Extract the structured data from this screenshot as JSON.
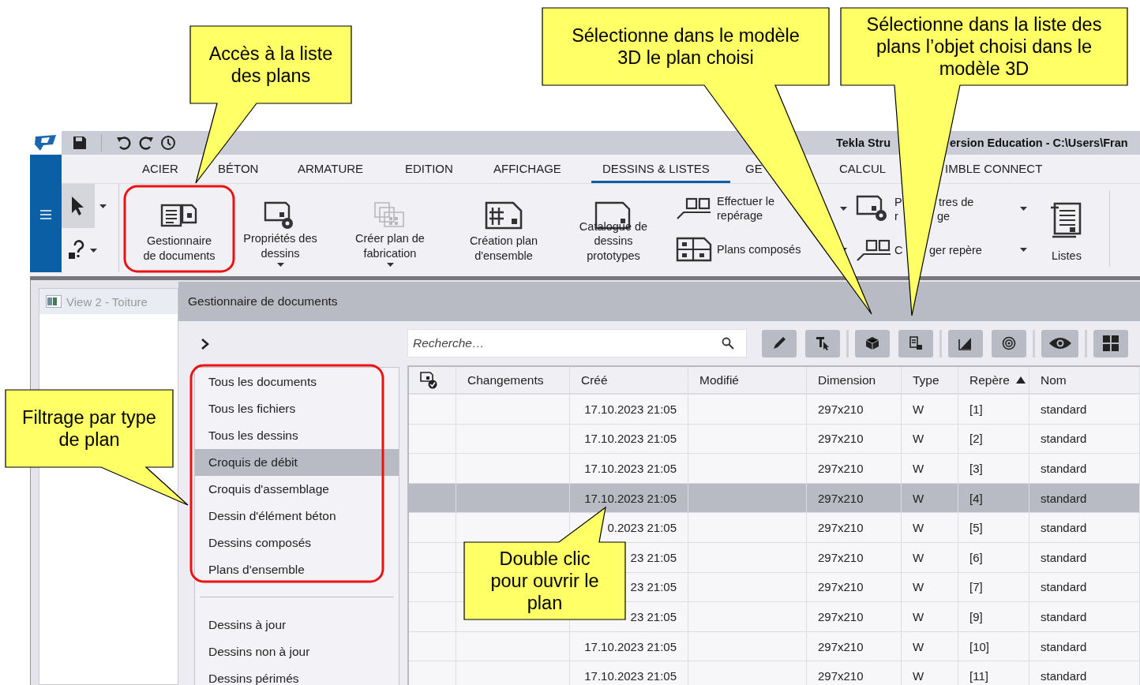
{
  "titlebar": {
    "title_parts": [
      "Tekla Stru",
      "ersion Education - C:\\Users\\Fran"
    ]
  },
  "ribbon": {
    "tabs": [
      {
        "label": "ACIER",
        "selected": false
      },
      {
        "label": "BÉTON",
        "selected": false
      },
      {
        "label": "ARMATURE",
        "selected": false
      },
      {
        "label": "EDITION",
        "selected": false
      },
      {
        "label": "AFFICHAGE",
        "selected": false
      },
      {
        "label": "DESSINS & LISTES",
        "selected": true
      },
      {
        "label": "GE",
        "selected": false
      },
      {
        "label": "CALCUL",
        "selected": false
      },
      {
        "label": "IMBLE CONNECT",
        "selected": false
      }
    ],
    "tools": [
      {
        "kind": "large",
        "lines": [
          "Gestionnaire",
          "de documents"
        ],
        "dropdown": false,
        "disabled": false
      },
      {
        "kind": "large",
        "lines": [
          "Propriétés des",
          "dessins"
        ],
        "dropdown": true,
        "disabled": false
      },
      {
        "kind": "large",
        "lines": [
          "Créer plan de",
          "fabrication"
        ],
        "dropdown": true,
        "disabled": true
      },
      {
        "kind": "large",
        "lines": [
          "Création plan",
          "d'ensemble"
        ],
        "dropdown": false,
        "disabled": false
      },
      {
        "kind": "large",
        "lines": [
          "Catalogue de",
          "dessins",
          "prototypes"
        ],
        "dropdown": false,
        "disabled": false
      },
      {
        "kind": "stack",
        "items": [
          {
            "lines": [
              [
                "Effectuer le"
              ],
              [
                "repérage"
              ]
            ],
            "dropdown": true
          },
          {
            "lines": [
              [
                "Plans composés"
              ]
            ],
            "dropdown": true
          }
        ]
      },
      {
        "kind": "stack",
        "items": [
          {
            "lines": [
              [
                "P",
                "tres de"
              ],
              [
                "r",
                "ge"
              ]
            ],
            "dropdown": true
          },
          {
            "lines": [
              [
                "C",
                "ger repère"
              ]
            ],
            "dropdown": true
          }
        ]
      },
      {
        "kind": "large",
        "lines": [
          "Listes"
        ],
        "dropdown": false,
        "disabled": false
      }
    ]
  },
  "view_panel": {
    "title": "View 2 - Toiture"
  },
  "document_manager": {
    "title": "Gestionnaire de documents",
    "search": {
      "placeholder": "Recherche…"
    },
    "filters": [
      {
        "label": "Tous les documents",
        "selected": false
      },
      {
        "label": "Tous les fichiers",
        "selected": false
      },
      {
        "label": "Tous les dessins",
        "selected": false
      },
      {
        "label": "Croquis de débit",
        "selected": true
      },
      {
        "label": "Croquis d'assemblage",
        "selected": false
      },
      {
        "label": "Dessin d'élément béton",
        "selected": false
      },
      {
        "label": "Dessins composés",
        "selected": false
      },
      {
        "label": "Plans d'ensemble",
        "selected": false
      }
    ],
    "status_filters": [
      {
        "label": "Dessins à jour",
        "selected": false
      },
      {
        "label": "Dessins non à jour",
        "selected": false
      },
      {
        "label": "Dessins périmés",
        "selected": false
      }
    ],
    "table": {
      "columns": [
        {
          "kind": "icon"
        },
        {
          "kind": "text",
          "label": "Changements"
        },
        {
          "kind": "text",
          "label": "Créé"
        },
        {
          "kind": "text",
          "label": "Modifié"
        },
        {
          "kind": "text",
          "label": "Dimension"
        },
        {
          "kind": "text",
          "label": "Type"
        },
        {
          "kind": "text",
          "label": "Repère",
          "sorted": true
        },
        {
          "kind": "text",
          "label": "Nom"
        }
      ],
      "rows": [
        {
          "selected": false,
          "created": "17.10.2023 21:05",
          "dimension": "297x210",
          "type": "W",
          "mark": "[1]",
          "name": "standard"
        },
        {
          "selected": false,
          "created": "17.10.2023 21:05",
          "dimension": "297x210",
          "type": "W",
          "mark": "[2]",
          "name": "standard"
        },
        {
          "selected": false,
          "created": "17.10.2023 21:05",
          "dimension": "297x210",
          "type": "W",
          "mark": "[3]",
          "name": "standard"
        },
        {
          "selected": true,
          "created": "17.10.2023 21:05",
          "dimension": "297x210",
          "type": "W",
          "mark": "[4]",
          "name": "standard"
        },
        {
          "selected": false,
          "created": "0.2023 21:05",
          "dimension": "297x210",
          "type": "W",
          "mark": "[5]",
          "name": "standard"
        },
        {
          "selected": false,
          "created": "23 21:05",
          "dimension": "297x210",
          "type": "W",
          "mark": "[6]",
          "name": "standard"
        },
        {
          "selected": false,
          "created": "23 21:05",
          "dimension": "297x210",
          "type": "W",
          "mark": "[7]",
          "name": "standard"
        },
        {
          "selected": false,
          "created": "23 21:05",
          "dimension": "297x210",
          "type": "W",
          "mark": "[9]",
          "name": "standard"
        },
        {
          "selected": false,
          "created": "17.10.2023 21:05",
          "dimension": "297x210",
          "type": "W",
          "mark": "[10]",
          "name": "standard"
        },
        {
          "selected": false,
          "created": "17.10.2023 21:05",
          "dimension": "297x210",
          "type": "W",
          "mark": "[11]",
          "name": "standard"
        }
      ]
    }
  },
  "callouts": [
    {
      "text": "Accès à la liste des plans"
    },
    {
      "text": "Sélectionne dans le modèle 3D le plan choisi"
    },
    {
      "text": "Sélectionne dans la liste des plans l’objet choisi dans le modèle 3D"
    },
    {
      "text": "Filtrage par type de plan"
    },
    {
      "text": "Double clic pour ouvrir le plan"
    }
  ]
}
